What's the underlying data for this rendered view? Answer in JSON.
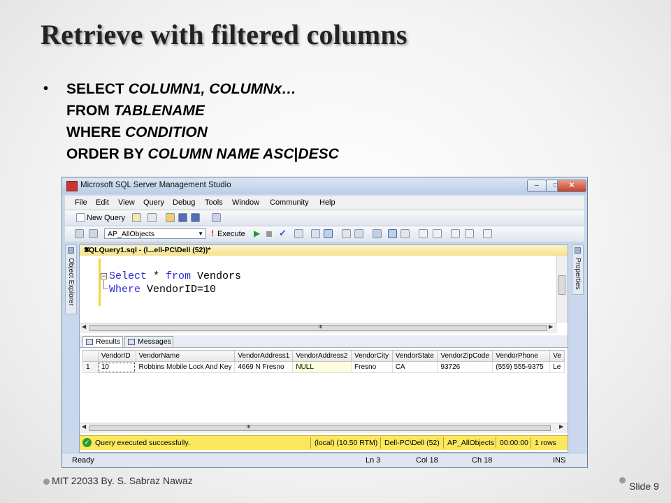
{
  "slide": {
    "title": "Retrieve with filtered columns",
    "bullet": "•",
    "sql": {
      "line1_kw": "SELECT ",
      "line1_it": "COLUMN1, COLUMNx…",
      "line2_kw": "FROM ",
      "line2_it": "TABLENAME",
      "line3_kw": "WHERE ",
      "line3_it": "CONDITION",
      "line4_kw": "ORDER BY ",
      "line4_it": "COLUMN NAME ASC",
      "line4_sep": "|",
      "line4_it2": "DESC"
    },
    "footer_left": "MIT 22033 By. S. Sabraz Nawaz",
    "footer_right": "Slide 9"
  },
  "window": {
    "title": "Microsoft SQL Server Management Studio",
    "controls": {
      "minimize": "–",
      "maximize": "□",
      "close": "✕"
    },
    "menu": [
      "File",
      "Edit",
      "View",
      "Query",
      "Debug",
      "Tools",
      "Window",
      "Community",
      "Help"
    ],
    "toolbar1": {
      "new_query": "New Query"
    },
    "toolbar2": {
      "database": "AP_AllObjects",
      "execute": "Execute"
    },
    "left_panel": "Object Explorer",
    "right_panel": "Properties",
    "doc_tab": "SQLQuery1.sql - (l...ell-PC\\Dell (52))*",
    "editor": {
      "line1_kw1": "Select",
      "line1_mid": " * ",
      "line1_kw2": "from",
      "line1_rest": " Vendors",
      "line2_kw": "Where",
      "line2_rest": " VendorID=10"
    },
    "scroll_grip": "III",
    "result_tabs": {
      "results": "Results",
      "messages": "Messages"
    },
    "grid": {
      "columns": [
        "",
        "VendorID",
        "VendorName",
        "VendorAddress1",
        "VendorAddress2",
        "VendorCity",
        "VendorState",
        "VendorZipCode",
        "VendorPhone",
        "Ve"
      ],
      "rows": [
        [
          "1",
          "10",
          "Robbins Mobile Lock And Key",
          "4669 N Fresno",
          "NULL",
          "Fresno",
          "CA",
          "93726",
          "(559) 555-9375",
          "Le"
        ]
      ]
    },
    "query_status": {
      "message": "Query executed successfully.",
      "server": "(local) (10.50 RTM)",
      "user": "Dell-PC\\Dell (52)",
      "database": "AP_AllObjects",
      "elapsed": "00:00:00",
      "rows": "1 rows"
    },
    "statusbar": {
      "ready": "Ready",
      "line": "Ln 3",
      "col": "Col 18",
      "ch": "Ch 18",
      "mode": "INS"
    }
  }
}
